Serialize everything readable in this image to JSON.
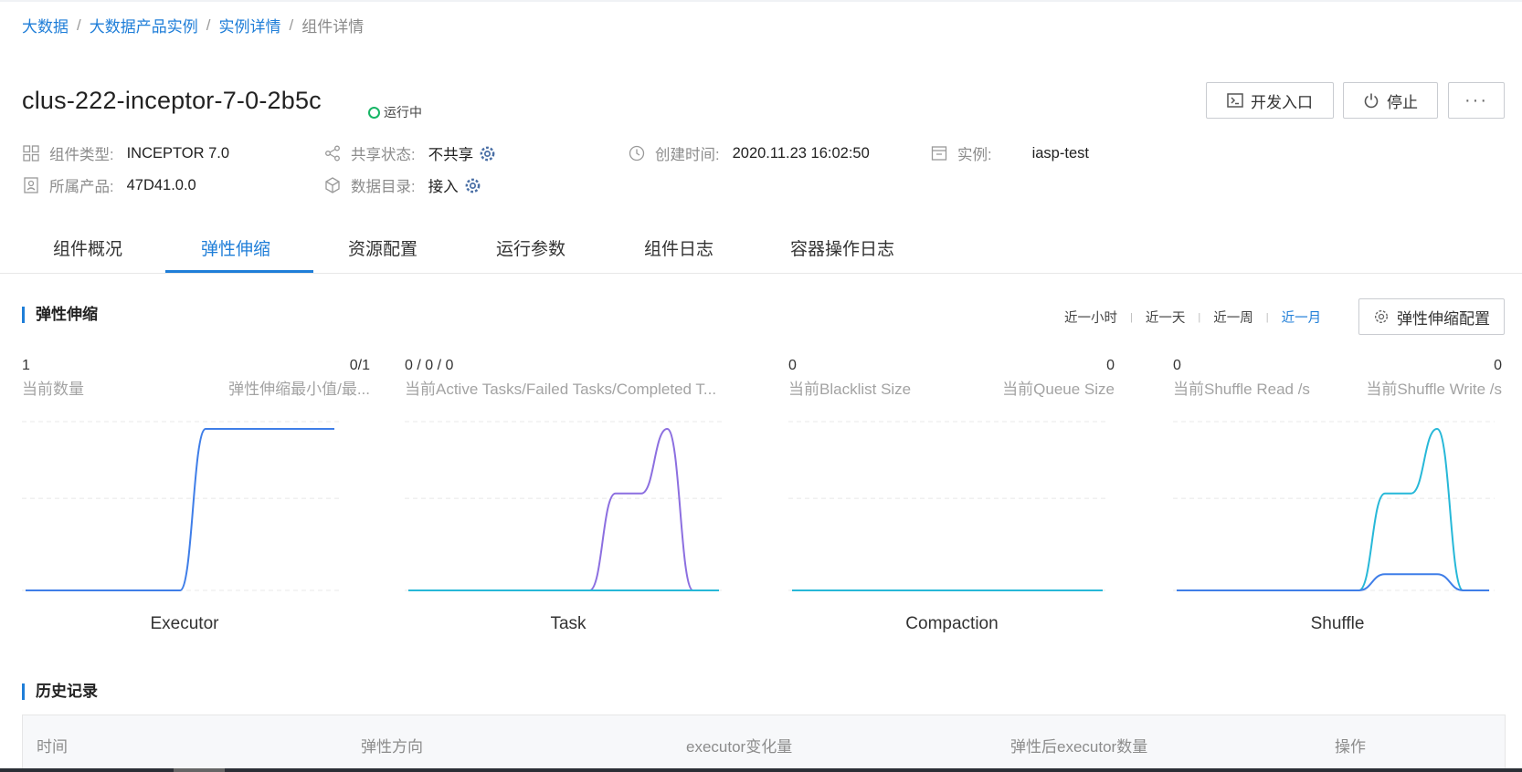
{
  "breadcrumb": {
    "items": [
      "大数据",
      "大数据产品实例",
      "实例详情"
    ],
    "current": "组件详情",
    "separator": "/"
  },
  "header": {
    "title": "clus-222-inceptor-7-0-2b5c",
    "status": "运行中",
    "status_color": "#18b566",
    "buttons": {
      "dev_entry": "开发入口",
      "stop": "停止",
      "more": "···"
    }
  },
  "info": {
    "component_type_label": "组件类型:",
    "component_type_value": "INCEPTOR 7.0",
    "product_label": "所属产品:",
    "product_value": "47D41.0.0",
    "share_label": "共享状态:",
    "share_value": "不共享",
    "catalog_label": "数据目录:",
    "catalog_value": "接入",
    "created_label": "创建时间:",
    "created_value": "2020.11.23 16:02:50",
    "instance_label": "实例:",
    "instance_value": "iasp-test"
  },
  "tabs": [
    "组件概况",
    "弹性伸缩",
    "资源配置",
    "运行参数",
    "组件日志",
    "容器操作日志"
  ],
  "active_tab": "弹性伸缩",
  "scaling": {
    "title": "弹性伸缩",
    "ranges": [
      "近一小时",
      "近一天",
      "近一周",
      "近一月"
    ],
    "active_range": "近一月",
    "config_button": "弹性伸缩配置"
  },
  "metrics": [
    {
      "left_value": "1",
      "left_label": "当前数量",
      "right_value": "0/1",
      "right_label": "弹性伸缩最小值/最..."
    },
    {
      "left_value": "0 / 0 / 0",
      "left_label": "当前Active Tasks/Failed Tasks/Completed T...",
      "right_value": "",
      "right_label": ""
    },
    {
      "left_value": "0",
      "left_label": "当前Blacklist Size",
      "right_value": "0",
      "right_label": "当前Queue Size"
    },
    {
      "left_value": "0",
      "left_label": "当前Shuffle Read /s",
      "right_value": "0",
      "right_label": "当前Shuffle Write /s"
    }
  ],
  "chart_data": [
    {
      "type": "line",
      "title": "Executor",
      "x": [
        0,
        1,
        2,
        3,
        4,
        5,
        6,
        7,
        8,
        9,
        10,
        11,
        12
      ],
      "series": [
        {
          "color": "#3f7ee8",
          "values": [
            0,
            0,
            0,
            0,
            0,
            0,
            0,
            1,
            1,
            1,
            1,
            1,
            1
          ]
        }
      ]
    },
    {
      "type": "line",
      "title": "Task",
      "x": [
        0,
        1,
        2,
        3,
        4,
        5,
        6,
        7,
        8,
        9,
        10,
        11,
        12
      ],
      "series": [
        {
          "color": "#8c6fe0",
          "values": [
            0,
            0,
            0,
            0,
            0,
            0,
            0,
            0,
            0.6,
            0.6,
            1,
            0,
            0
          ]
        },
        {
          "color": "#27b8d8",
          "values": [
            0,
            0,
            0,
            0,
            0,
            0,
            0,
            0,
            0,
            0,
            0,
            0,
            0
          ]
        }
      ]
    },
    {
      "type": "line",
      "title": "Compaction",
      "x": [
        0,
        1,
        2,
        3,
        4,
        5,
        6,
        7,
        8,
        9,
        10,
        11,
        12
      ],
      "series": [
        {
          "color": "#27b8d8",
          "values": [
            0,
            0,
            0,
            0,
            0,
            0,
            0,
            0,
            0,
            0,
            0,
            0,
            0
          ]
        }
      ]
    },
    {
      "type": "line",
      "title": "Shuffle",
      "x": [
        0,
        1,
        2,
        3,
        4,
        5,
        6,
        7,
        8,
        9,
        10,
        11,
        12
      ],
      "series": [
        {
          "color": "#27b8d8",
          "values": [
            0,
            0,
            0,
            0,
            0,
            0,
            0,
            0,
            0.6,
            0.6,
            1,
            0,
            0
          ]
        },
        {
          "color": "#3f7ee8",
          "values": [
            0,
            0,
            0,
            0,
            0,
            0,
            0,
            0,
            0.1,
            0.1,
            0.1,
            0,
            0
          ]
        }
      ]
    }
  ],
  "history": {
    "title": "历史记录",
    "columns": [
      "时间",
      "弹性方向",
      "executor变化量",
      "弹性后executor数量",
      "操作"
    ]
  }
}
